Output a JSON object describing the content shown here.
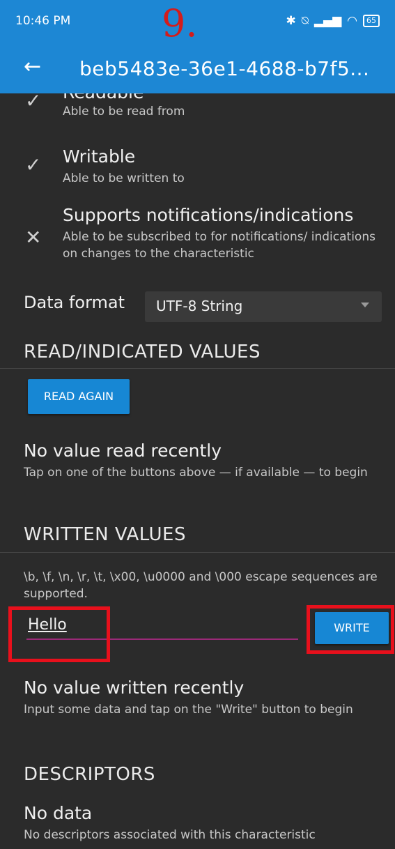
{
  "status_bar": {
    "time": "10:46 PM",
    "step_marker": "9.",
    "battery": "65"
  },
  "app_bar": {
    "title": "beb5483e-36e1-4688-b7f5..."
  },
  "properties": [
    {
      "title": "Readable",
      "desc": "Able to be read from",
      "icon": "check-icon",
      "supported": true
    },
    {
      "title": "Writable",
      "desc": "Able to be written to",
      "icon": "check-icon",
      "supported": true
    },
    {
      "title": "Supports notifications/indications",
      "desc": "Able to be subscribed to for notifications/ indications on changes to the characteristic",
      "icon": "close-icon",
      "supported": false
    }
  ],
  "data_format": {
    "label": "Data format",
    "value": "UTF-8 String"
  },
  "read_section": {
    "heading": "READ/INDICATED VALUES",
    "button": "READ AGAIN",
    "empty_title": "No value read recently",
    "empty_desc": "Tap on one of the buttons above — if available — to begin"
  },
  "written_section": {
    "heading": "WRITTEN VALUES",
    "hint": "\\b, \\f, \\n, \\r, \\t, \\x00, \\u0000 and \\000 escape sequences are supported.",
    "input_value": "Hello",
    "write_button": "WRITE",
    "empty_title": "No value written recently",
    "empty_desc": "Input some data and tap on the \"Write\" button to begin"
  },
  "descriptors_section": {
    "heading": "DESCRIPTORS",
    "empty_title": "No data",
    "empty_desc": "No descriptors associated with this characteristic"
  },
  "colors": {
    "accent": "#1d87d4",
    "highlight": "#e8101c",
    "background": "#2b2b2b"
  }
}
